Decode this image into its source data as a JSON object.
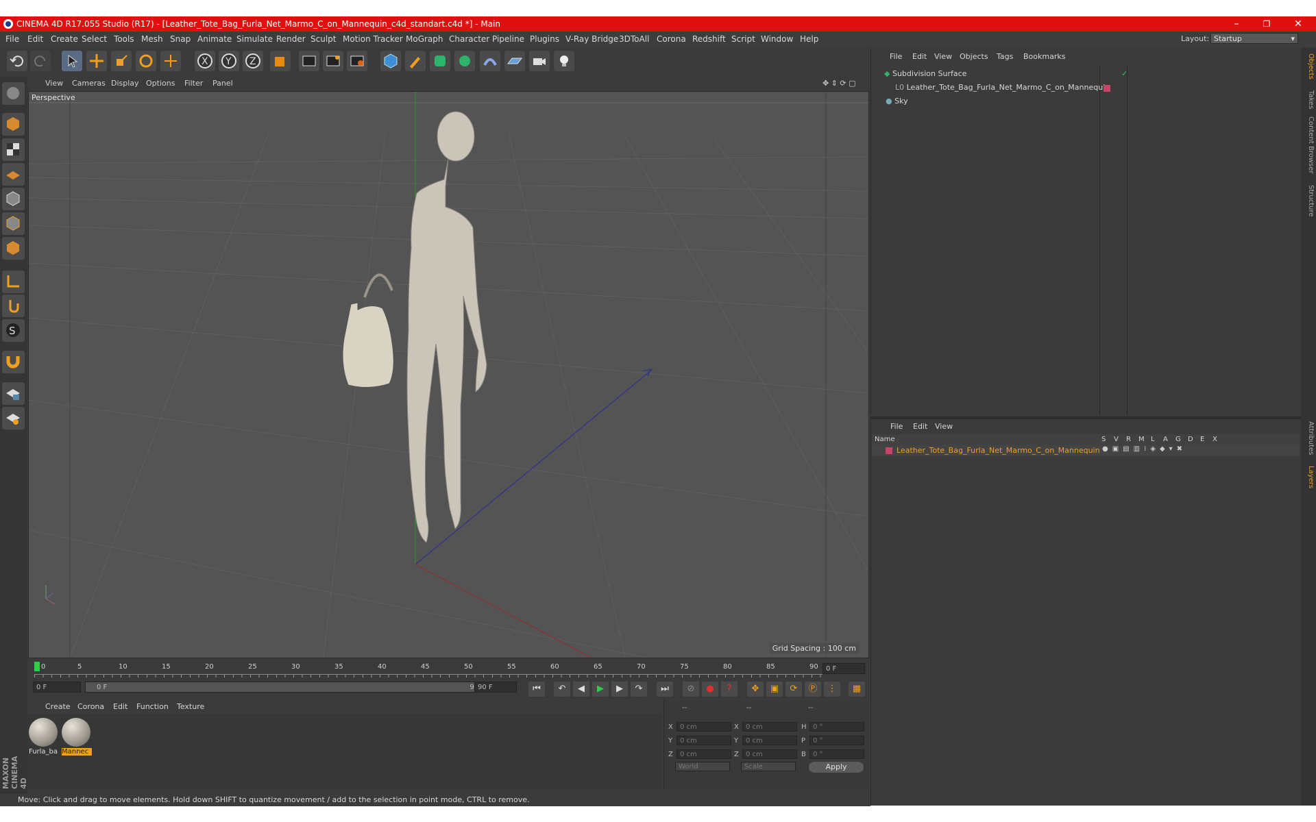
{
  "window": {
    "title": "CINEMA 4D R17.055 Studio (R17) - [Leather_Tote_Bag_Furla_Net_Marmo_C_on_Mannequin_c4d_standart.c4d *] - Main",
    "minimize": "–",
    "maximize": "❐",
    "close": "✕"
  },
  "menu": [
    "File",
    "Edit",
    "Create",
    "Select",
    "Tools",
    "Mesh",
    "Snap",
    "Animate",
    "Simulate",
    "Render",
    "Sculpt",
    "Motion Tracker",
    "MoGraph",
    "Character",
    "Pipeline",
    "Plugins",
    "V-Ray Bridge",
    "3DToAll",
    "Corona",
    "Redshift",
    "Script",
    "Window",
    "Help"
  ],
  "layout": {
    "label": "Layout:",
    "value": "Startup"
  },
  "viewport": {
    "menu": [
      "View",
      "Cameras",
      "Display",
      "Options",
      "Filter",
      "Panel"
    ],
    "label": "Perspective",
    "grid_spacing": "Grid Spacing : 100 cm"
  },
  "timeline": {
    "ticks": [
      "0",
      "5",
      "10",
      "15",
      "20",
      "25",
      "30",
      "35",
      "40",
      "45",
      "50",
      "55",
      "60",
      "65",
      "70",
      "75",
      "80",
      "85",
      "90"
    ],
    "current": "0 F",
    "start": "0 F",
    "range_start": "0 F",
    "range_end": "90 F",
    "end": "90 F"
  },
  "material_manager": {
    "menu": [
      "Create",
      "Corona",
      "Edit",
      "Function",
      "Texture"
    ],
    "materials": [
      "Furla_ba",
      "Mannec"
    ]
  },
  "coordinates": {
    "header": [
      "--",
      "--",
      "--"
    ],
    "rows": [
      {
        "a": "X",
        "av": "0 cm",
        "b": "X",
        "bv": "0 cm",
        "c": "H",
        "cv": "0 °"
      },
      {
        "a": "Y",
        "av": "0 cm",
        "b": "Y",
        "bv": "0 cm",
        "c": "P",
        "cv": "0 °"
      },
      {
        "a": "Z",
        "av": "0 cm",
        "b": "Z",
        "bv": "0 cm",
        "c": "B",
        "cv": "0 °"
      }
    ],
    "mode1": "World",
    "mode2": "Scale",
    "apply": "Apply"
  },
  "status": "Move: Click and drag to move elements. Hold down SHIFT to quantize movement / add to the selection in point mode, CTRL to remove.",
  "object_manager": {
    "menu": [
      "File",
      "Edit",
      "View",
      "Objects",
      "Tags",
      "Bookmarks"
    ],
    "objects": [
      "Subdivision Surface",
      "Leather_Tote_Bag_Furla_Net_Marmo_C_on_Mannequin",
      "Sky"
    ]
  },
  "layer_manager": {
    "menu": [
      "File",
      "Edit",
      "View"
    ],
    "columns": [
      "Name",
      "S",
      "V",
      "R",
      "M",
      "L",
      "A",
      "G",
      "D",
      "E",
      "X"
    ],
    "layer": "Leather_Tote_Bag_Furla_Net_Marmo_C_on_Mannequin"
  },
  "right_tabs": [
    "Objects",
    "Takes",
    "Content Browser",
    "Structure",
    "Attributes",
    "Layers"
  ],
  "brand": "MAXON CINEMA 4D",
  "colors": {
    "title_bar": "#e01010",
    "accent": "#f0a020",
    "layer_color": "#c8456a"
  }
}
